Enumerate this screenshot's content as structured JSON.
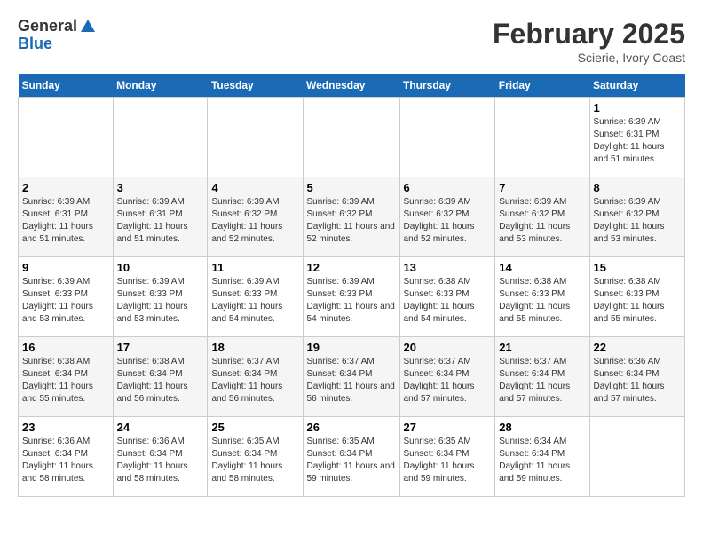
{
  "logo": {
    "general": "General",
    "blue": "Blue"
  },
  "header": {
    "month": "February 2025",
    "location": "Scierie, Ivory Coast"
  },
  "weekdays": [
    "Sunday",
    "Monday",
    "Tuesday",
    "Wednesday",
    "Thursday",
    "Friday",
    "Saturday"
  ],
  "weeks": [
    [
      {
        "day": "",
        "info": ""
      },
      {
        "day": "",
        "info": ""
      },
      {
        "day": "",
        "info": ""
      },
      {
        "day": "",
        "info": ""
      },
      {
        "day": "",
        "info": ""
      },
      {
        "day": "",
        "info": ""
      },
      {
        "day": "1",
        "info": "Sunrise: 6:39 AM\nSunset: 6:31 PM\nDaylight: 11 hours and 51 minutes."
      }
    ],
    [
      {
        "day": "2",
        "info": "Sunrise: 6:39 AM\nSunset: 6:31 PM\nDaylight: 11 hours and 51 minutes."
      },
      {
        "day": "3",
        "info": "Sunrise: 6:39 AM\nSunset: 6:31 PM\nDaylight: 11 hours and 51 minutes."
      },
      {
        "day": "4",
        "info": "Sunrise: 6:39 AM\nSunset: 6:32 PM\nDaylight: 11 hours and 52 minutes."
      },
      {
        "day": "5",
        "info": "Sunrise: 6:39 AM\nSunset: 6:32 PM\nDaylight: 11 hours and 52 minutes."
      },
      {
        "day": "6",
        "info": "Sunrise: 6:39 AM\nSunset: 6:32 PM\nDaylight: 11 hours and 52 minutes."
      },
      {
        "day": "7",
        "info": "Sunrise: 6:39 AM\nSunset: 6:32 PM\nDaylight: 11 hours and 53 minutes."
      },
      {
        "day": "8",
        "info": "Sunrise: 6:39 AM\nSunset: 6:32 PM\nDaylight: 11 hours and 53 minutes."
      }
    ],
    [
      {
        "day": "9",
        "info": "Sunrise: 6:39 AM\nSunset: 6:33 PM\nDaylight: 11 hours and 53 minutes."
      },
      {
        "day": "10",
        "info": "Sunrise: 6:39 AM\nSunset: 6:33 PM\nDaylight: 11 hours and 53 minutes."
      },
      {
        "day": "11",
        "info": "Sunrise: 6:39 AM\nSunset: 6:33 PM\nDaylight: 11 hours and 54 minutes."
      },
      {
        "day": "12",
        "info": "Sunrise: 6:39 AM\nSunset: 6:33 PM\nDaylight: 11 hours and 54 minutes."
      },
      {
        "day": "13",
        "info": "Sunrise: 6:38 AM\nSunset: 6:33 PM\nDaylight: 11 hours and 54 minutes."
      },
      {
        "day": "14",
        "info": "Sunrise: 6:38 AM\nSunset: 6:33 PM\nDaylight: 11 hours and 55 minutes."
      },
      {
        "day": "15",
        "info": "Sunrise: 6:38 AM\nSunset: 6:33 PM\nDaylight: 11 hours and 55 minutes."
      }
    ],
    [
      {
        "day": "16",
        "info": "Sunrise: 6:38 AM\nSunset: 6:34 PM\nDaylight: 11 hours and 55 minutes."
      },
      {
        "day": "17",
        "info": "Sunrise: 6:38 AM\nSunset: 6:34 PM\nDaylight: 11 hours and 56 minutes."
      },
      {
        "day": "18",
        "info": "Sunrise: 6:37 AM\nSunset: 6:34 PM\nDaylight: 11 hours and 56 minutes."
      },
      {
        "day": "19",
        "info": "Sunrise: 6:37 AM\nSunset: 6:34 PM\nDaylight: 11 hours and 56 minutes."
      },
      {
        "day": "20",
        "info": "Sunrise: 6:37 AM\nSunset: 6:34 PM\nDaylight: 11 hours and 57 minutes."
      },
      {
        "day": "21",
        "info": "Sunrise: 6:37 AM\nSunset: 6:34 PM\nDaylight: 11 hours and 57 minutes."
      },
      {
        "day": "22",
        "info": "Sunrise: 6:36 AM\nSunset: 6:34 PM\nDaylight: 11 hours and 57 minutes."
      }
    ],
    [
      {
        "day": "23",
        "info": "Sunrise: 6:36 AM\nSunset: 6:34 PM\nDaylight: 11 hours and 58 minutes."
      },
      {
        "day": "24",
        "info": "Sunrise: 6:36 AM\nSunset: 6:34 PM\nDaylight: 11 hours and 58 minutes."
      },
      {
        "day": "25",
        "info": "Sunrise: 6:35 AM\nSunset: 6:34 PM\nDaylight: 11 hours and 58 minutes."
      },
      {
        "day": "26",
        "info": "Sunrise: 6:35 AM\nSunset: 6:34 PM\nDaylight: 11 hours and 59 minutes."
      },
      {
        "day": "27",
        "info": "Sunrise: 6:35 AM\nSunset: 6:34 PM\nDaylight: 11 hours and 59 minutes."
      },
      {
        "day": "28",
        "info": "Sunrise: 6:34 AM\nSunset: 6:34 PM\nDaylight: 11 hours and 59 minutes."
      },
      {
        "day": "",
        "info": ""
      }
    ]
  ]
}
